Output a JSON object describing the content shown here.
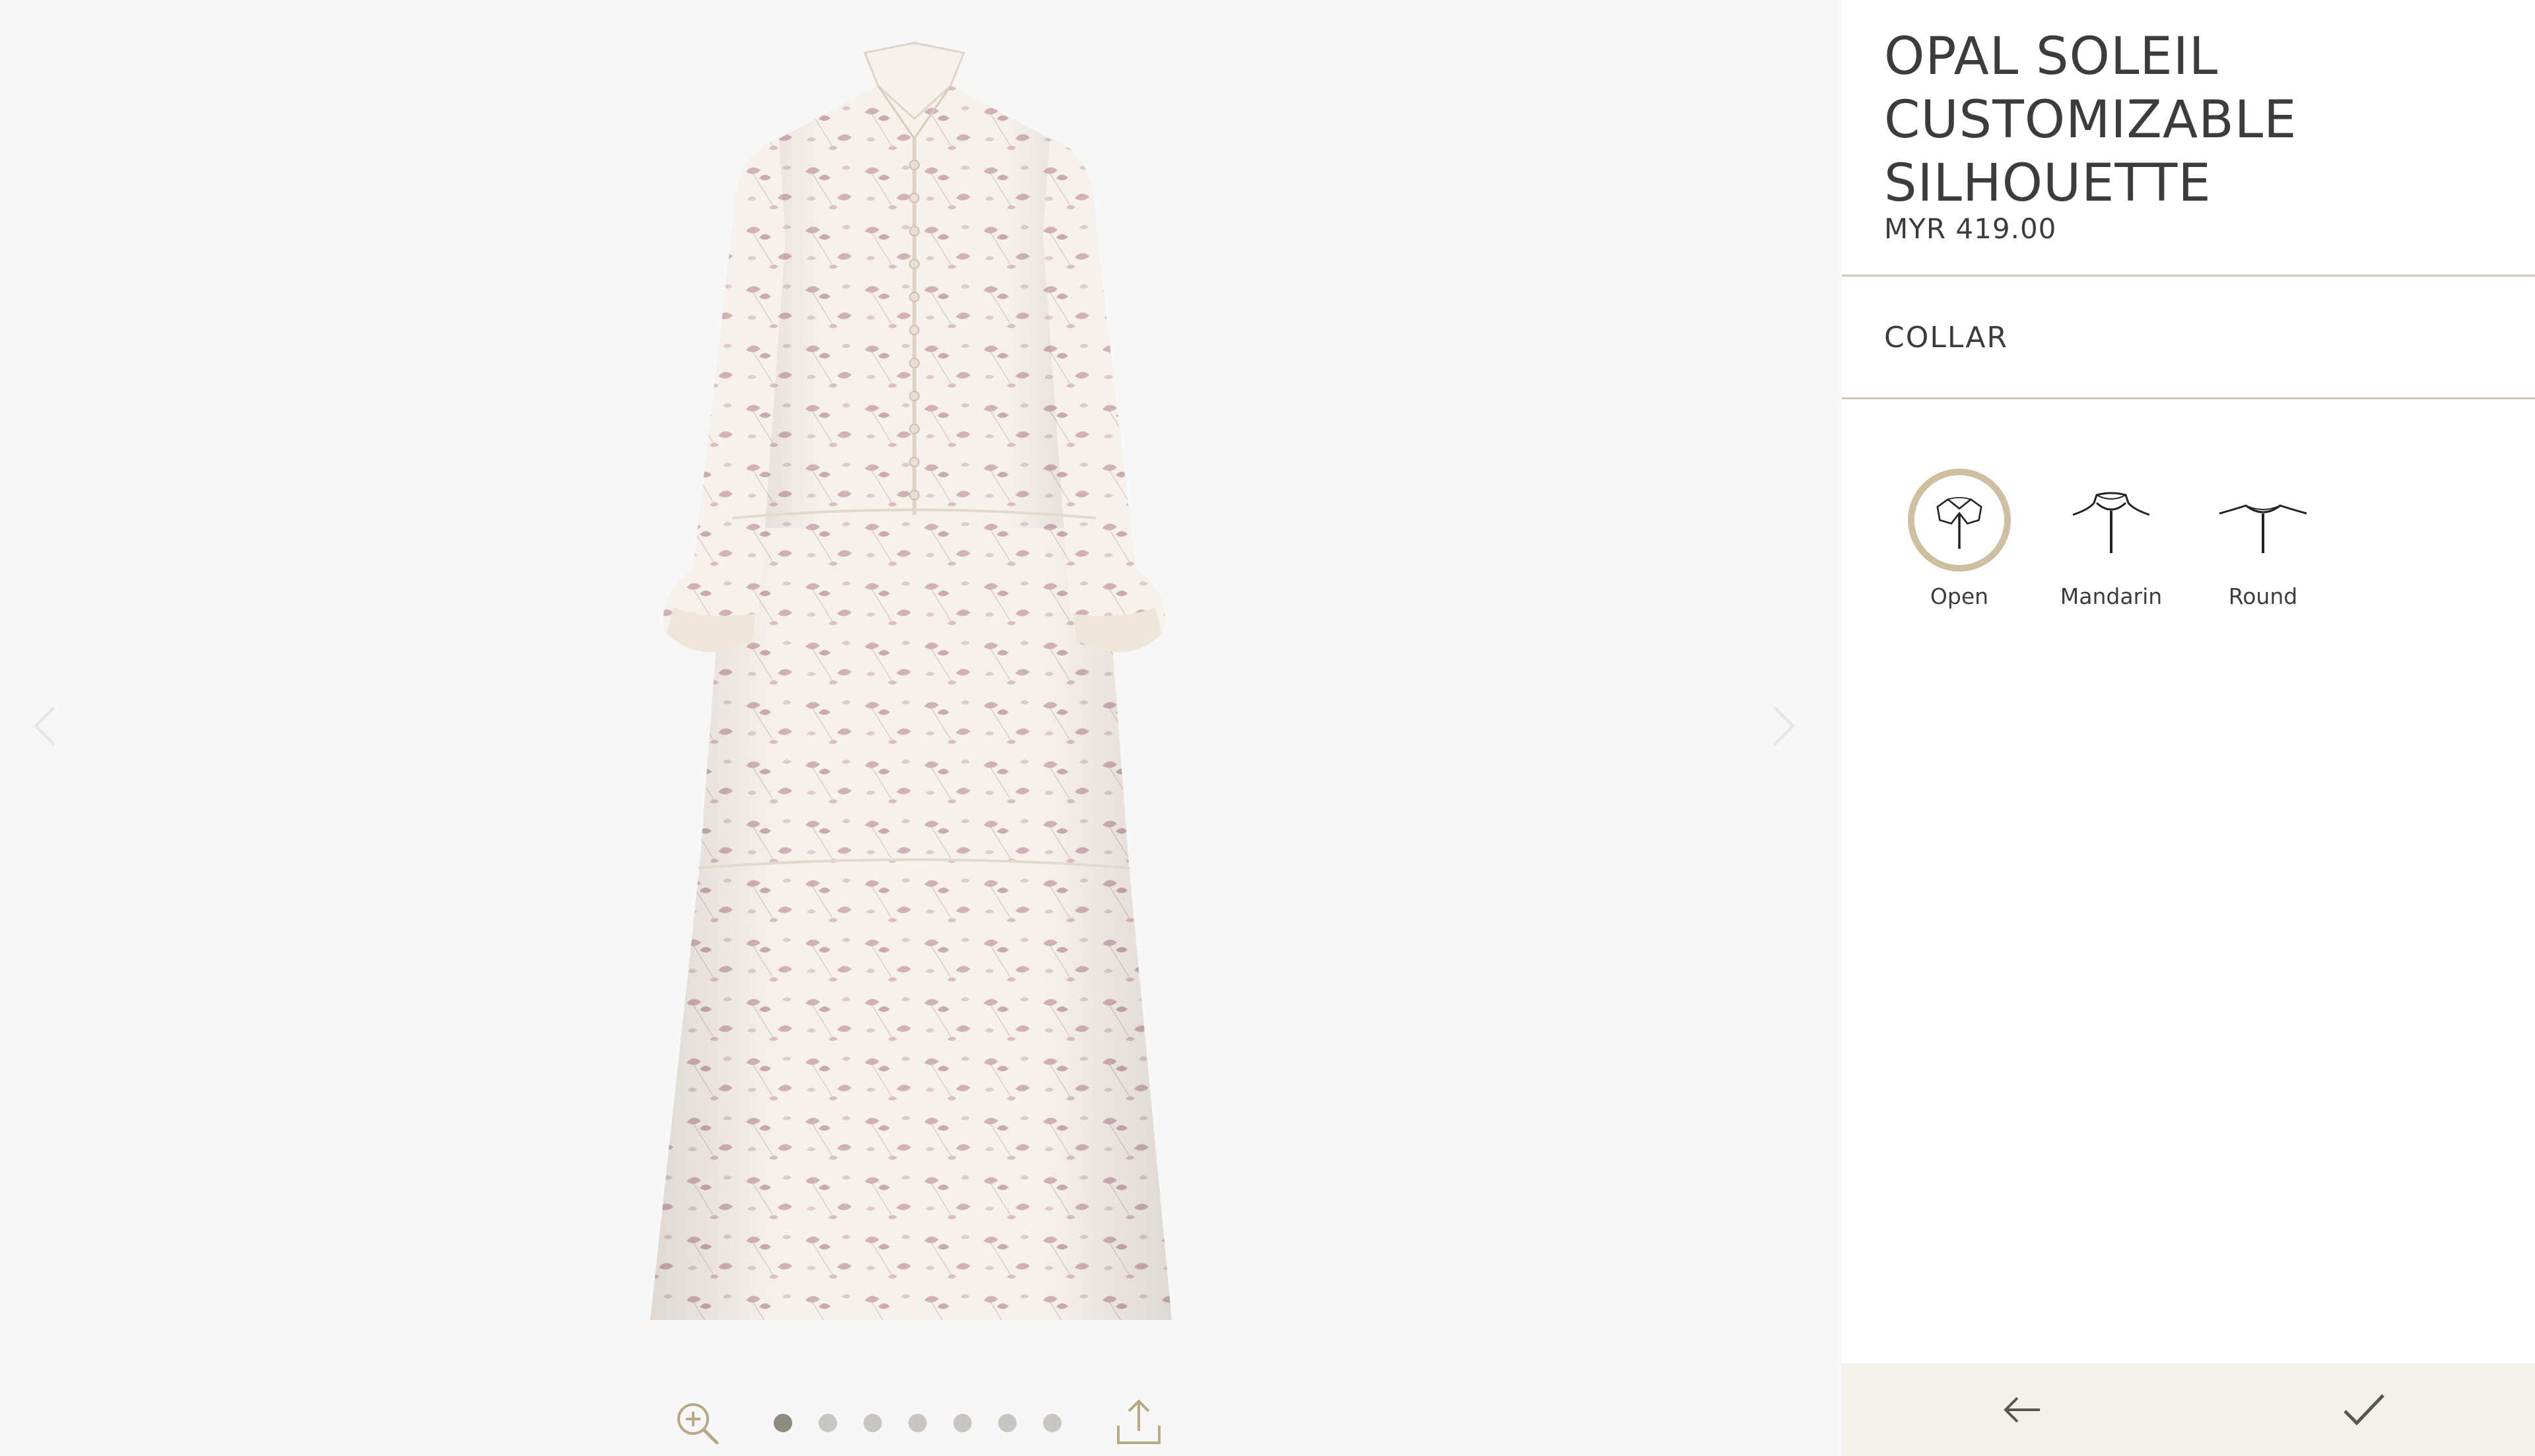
{
  "product": {
    "title": "OPAL SOLEIL CUSTOMIZABLE SILHOUETTE",
    "price": "MYR 419.00"
  },
  "section": {
    "title": "COLLAR"
  },
  "collar_options": [
    {
      "label": "Open",
      "icon": "open-collar-icon",
      "selected": true
    },
    {
      "label": "Mandarin",
      "icon": "mandarin-collar-icon",
      "selected": false
    },
    {
      "label": "Round",
      "icon": "round-collar-icon",
      "selected": false
    }
  ],
  "viewer": {
    "image_count": 7,
    "active_image": 1,
    "icons": [
      "zoom-in-icon",
      "share-icon",
      "chevron-left-icon",
      "chevron-right-icon"
    ]
  },
  "footer": {
    "icons": [
      "arrow-left-icon",
      "checkmark-icon"
    ]
  },
  "colors": {
    "accent": "#cdbf9f",
    "divider": "#cfc6b4",
    "footer_bg": "#f4f1ea",
    "viewer_bg": "#f7f7f7",
    "text": "#3c3c3c",
    "dress_print": "#b88a98"
  }
}
